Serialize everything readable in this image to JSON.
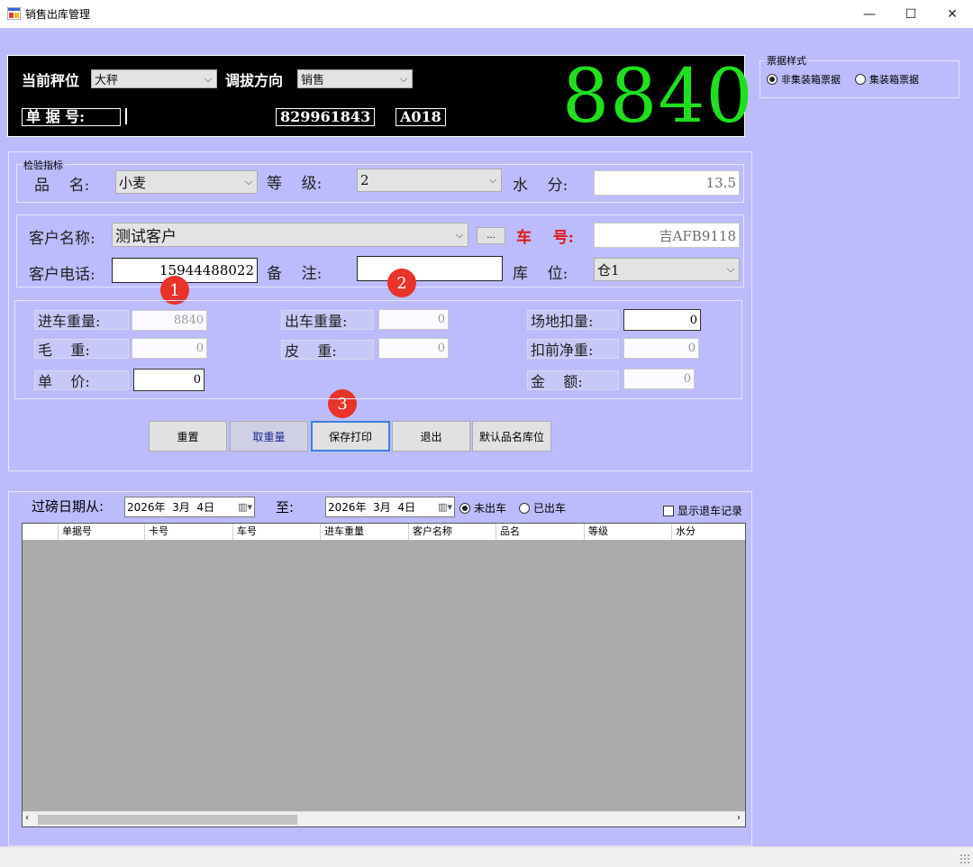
{
  "window": {
    "title": "销售出库管理",
    "minimize": "—",
    "maximize": "☐",
    "close": "✕"
  },
  "scale_panel": {
    "current_scale_label": "当前秤位",
    "current_scale_value": "大秤",
    "direction_label": "调拔方向",
    "direction_value": "销售",
    "doc_no_label": "单 据 号:",
    "doc_no_value": "829961843",
    "code_value": "A018",
    "weight": "8840"
  },
  "ticket_style": {
    "caption": "票据样式",
    "options": [
      "非集装箱票据",
      "集装箱票据"
    ],
    "selected": 0
  },
  "inspection": {
    "caption": "检验指标",
    "product_label": "品    名:",
    "product_value": "小麦",
    "grade_label": "等    级:",
    "grade_value": "2",
    "moisture_label": "水    分:",
    "moisture_value": "13.5"
  },
  "customer": {
    "name_label": "客户名称:",
    "name_value": "测试客户",
    "browse_button": "...",
    "car_label": "车    号:",
    "car_value": "吉AFB9118",
    "phone_label": "客户电话:",
    "phone_value": "15944488022",
    "remark_label": "备    注:",
    "remark_value": "",
    "warehouse_label": "库    位:",
    "warehouse_value": "仓1"
  },
  "weights": {
    "in_weight_label": "进车重量:",
    "in_weight_value": "8840",
    "out_weight_label": "出车重量:",
    "out_weight_value": "0",
    "site_deduct_label": "场地扣量:",
    "site_deduct_value": "0",
    "gross_label": "毛    重:",
    "gross_value": "0",
    "tare_label": "皮    重:",
    "tare_value": "0",
    "net_before_label": "扣前净重:",
    "net_before_value": "0",
    "unit_price_label": "单    价:",
    "unit_price_value": "0",
    "amount_label": "金    额:",
    "amount_value": "0"
  },
  "badges": [
    "1",
    "2",
    "3"
  ],
  "buttons": {
    "reset": "重置",
    "take_weight": "取重量",
    "save_print": "保存打印",
    "exit": "退出",
    "default_product_location": "默认品名库位"
  },
  "filter": {
    "date_from_label": "过磅日期从:",
    "date_from": "2026年  3月  4日",
    "to_label": "至:",
    "date_to": "2026年  3月  4日",
    "radio_options": [
      "未出车",
      "已出车"
    ],
    "radio_selected": 0,
    "show_returned_label": "显示退车记录",
    "show_returned_checked": false
  },
  "grid": {
    "columns": [
      "单据号",
      "卡号",
      "车号",
      "进车重量",
      "客户名称",
      "品名",
      "等级",
      "水分"
    ]
  },
  "colors": {
    "client_bg": "#bcbcfc",
    "weight_digits": "#1fe01f",
    "car_label_red": "#e01818",
    "badge_red": "#e8332a"
  }
}
